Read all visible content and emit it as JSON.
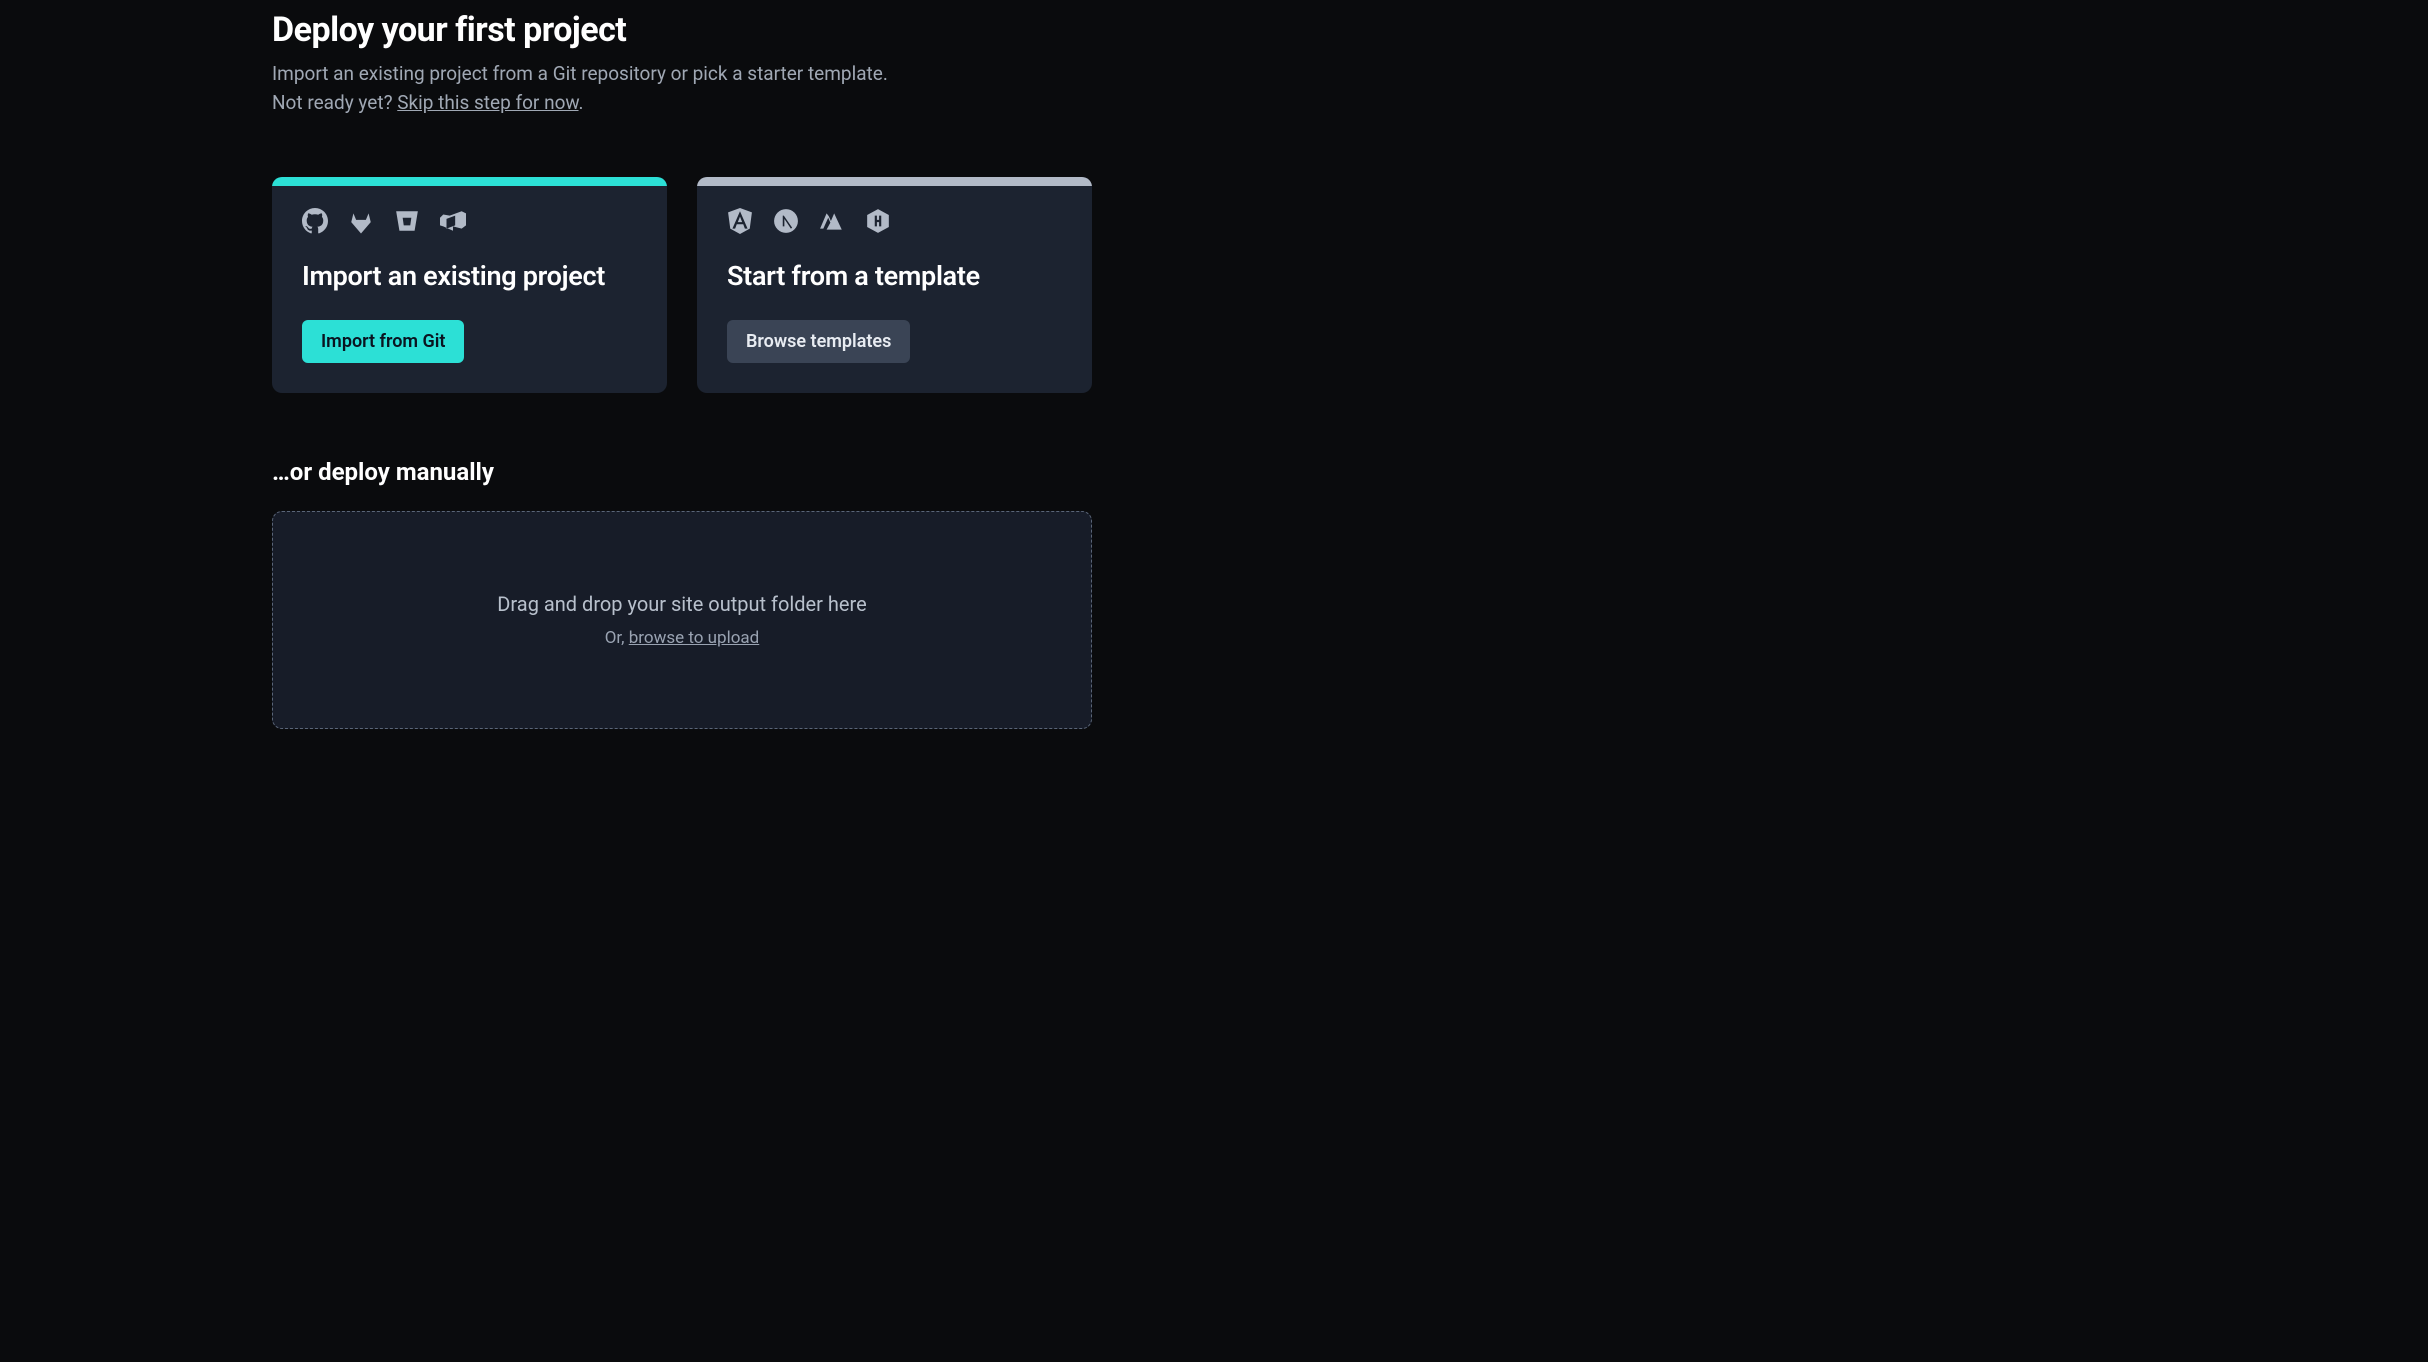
{
  "header": {
    "title": "Deploy your first project",
    "subtitle": "Import an existing project from a Git repository or pick a starter template.",
    "not_ready_prefix": "Not ready yet? ",
    "skip_link_text": "Skip this step for now",
    "period": "."
  },
  "cards": {
    "import": {
      "title": "Import an existing project",
      "button_label": "Import from Git"
    },
    "template": {
      "title": "Start from a template",
      "button_label": "Browse templates"
    }
  },
  "manual": {
    "section_title": "…or deploy manually",
    "dropzone_title": "Drag and drop your site output folder here",
    "or_prefix": "Or, ",
    "browse_link": "browse to upload"
  }
}
